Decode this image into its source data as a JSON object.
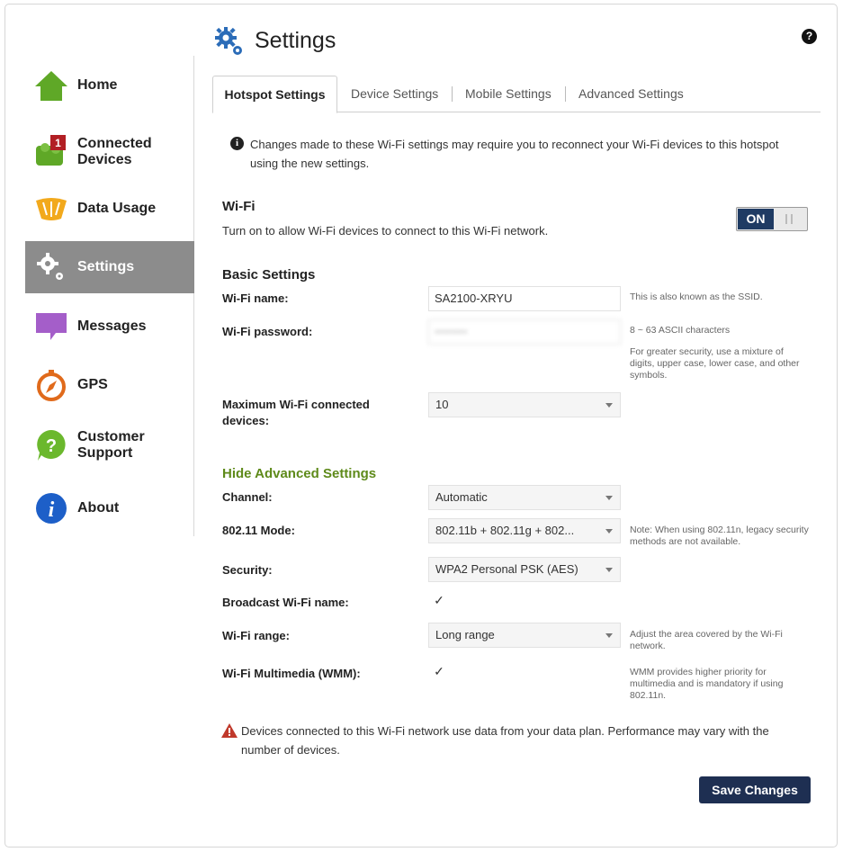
{
  "header": {
    "title": "Settings",
    "help_icon": "?"
  },
  "sidebar": {
    "items": [
      {
        "label": "Home",
        "icon": "home-icon"
      },
      {
        "label": "Connected Devices",
        "icon": "connected-devices-icon",
        "badge": "1"
      },
      {
        "label": "Data Usage",
        "icon": "data-usage-icon"
      },
      {
        "label": "Settings",
        "icon": "settings-gear-icon",
        "active": true
      },
      {
        "label": "Messages",
        "icon": "messages-icon"
      },
      {
        "label": "GPS",
        "icon": "gps-compass-icon"
      },
      {
        "label": "Customer Support",
        "icon": "customer-support-icon"
      },
      {
        "label": "About",
        "icon": "about-info-icon"
      }
    ]
  },
  "tabs": [
    {
      "label": "Hotspot Settings",
      "active": true
    },
    {
      "label": "Device Settings"
    },
    {
      "label": "Mobile Settings"
    },
    {
      "label": "Advanced Settings"
    }
  ],
  "info": {
    "icon": "i",
    "text": "Changes made to these Wi-Fi settings may require you to reconnect your Wi-Fi devices to this hotspot using the new settings."
  },
  "wifi": {
    "heading": "Wi-Fi",
    "description": "Turn on to allow Wi-Fi devices to connect to this Wi-Fi network.",
    "toggle_label": "ON"
  },
  "basic": {
    "heading": "Basic Settings",
    "name_label": "Wi-Fi name:",
    "name_value": "SA2100-XRYU",
    "name_note": "This is also known as the SSID.",
    "password_label": "Wi-Fi password:",
    "password_value": "••••••••",
    "password_note1": "8 ~ 63 ASCII characters",
    "password_note2": "For greater security, use a mixture of digits, upper case, lower case, and other symbols.",
    "max_label": "Maximum Wi-Fi connected devices:",
    "max_value": "10"
  },
  "advanced": {
    "toggle_link": "Hide Advanced Settings",
    "channel_label": "Channel:",
    "channel_value": "Automatic",
    "mode_label": "802.11 Mode:",
    "mode_value": "802.11b + 802.11g + 802...",
    "mode_note": "Note: When using 802.11n, legacy security methods are not available.",
    "security_label": "Security:",
    "security_value": "WPA2 Personal PSK (AES)",
    "broadcast_label": "Broadcast Wi-Fi name:",
    "broadcast_checked": true,
    "range_label": "Wi-Fi range:",
    "range_value": "Long range",
    "range_note": "Adjust the area covered by the Wi-Fi network.",
    "wmm_label": "Wi-Fi Multimedia (WMM):",
    "wmm_checked": true,
    "wmm_note": "WMM provides higher priority for multimedia and is mandatory if using 802.11n."
  },
  "warning": {
    "text": "Devices connected to this Wi-Fi network use data from your data plan. Performance may vary with the number of devices."
  },
  "save_label": "Save Changes",
  "colors": {
    "accent_navy": "#1f3b63",
    "link_green": "#5e8a1a",
    "active_nav": "#8c8c8c",
    "warning_red": "#c0392b"
  }
}
